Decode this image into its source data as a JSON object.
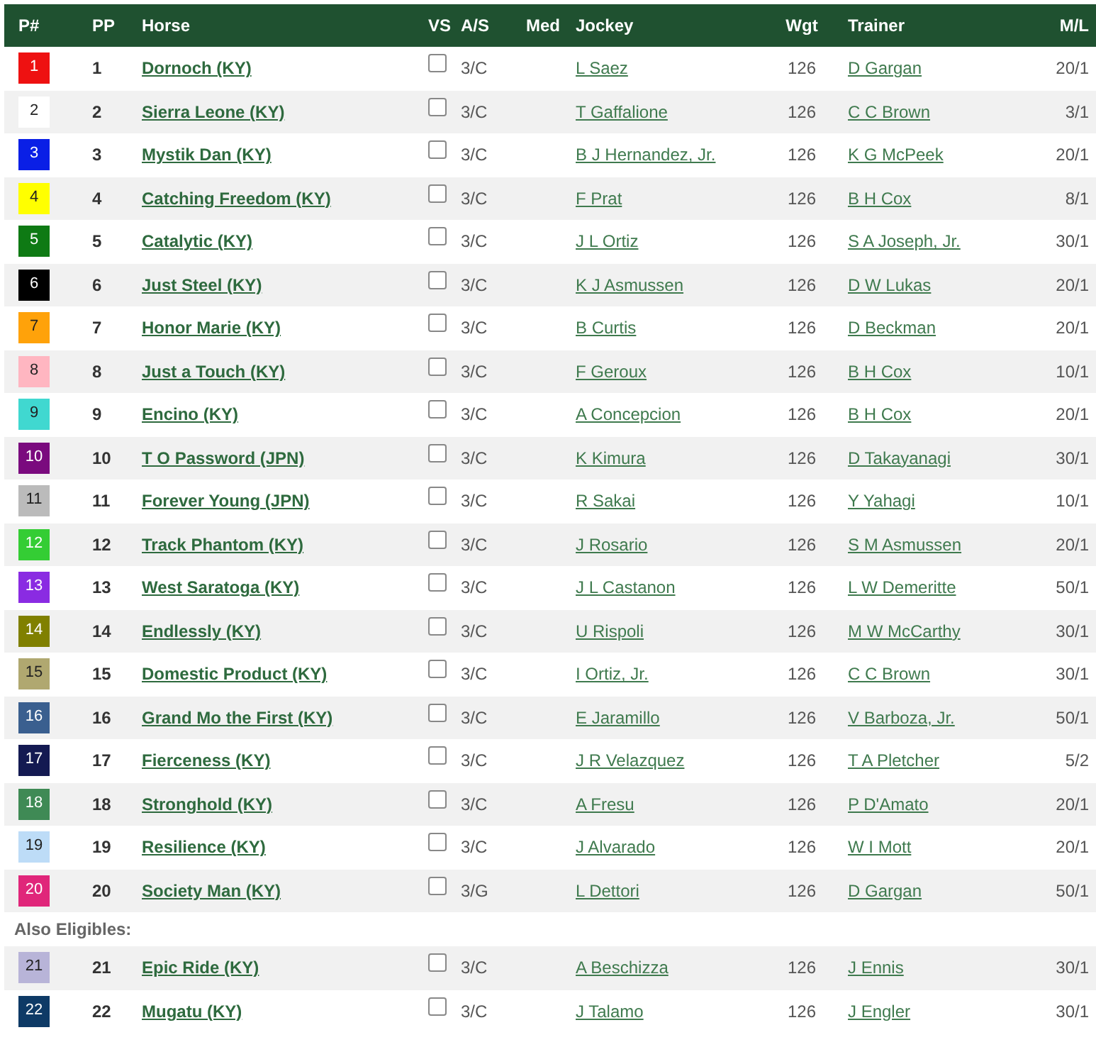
{
  "table": {
    "columns": [
      "P#",
      "PP",
      "Horse",
      "VS",
      "A/S",
      "Med",
      "Jockey",
      "Wgt",
      "Trainer",
      "M/L"
    ],
    "rows": [
      {
        "kind": "entry",
        "program": "1",
        "color": "#ee1111",
        "post": "1",
        "horse": "Dornoch (KY)",
        "vs_checked": false,
        "age_sex": "3/C",
        "jockey": "L Saez",
        "weight": "126",
        "trainer": "D Gargan",
        "odds": "20/1"
      },
      {
        "kind": "entry",
        "program": "2",
        "color": "#ffffff",
        "post": "2",
        "horse": "Sierra Leone (KY)",
        "vs_checked": false,
        "age_sex": "3/C",
        "jockey": "T Gaffalione",
        "weight": "126",
        "trainer": "C C Brown",
        "odds": "3/1"
      },
      {
        "kind": "entry",
        "program": "3",
        "color": "#0a1fe6",
        "post": "3",
        "horse": "Mystik Dan (KY)",
        "vs_checked": false,
        "age_sex": "3/C",
        "jockey": "B J Hernandez, Jr.",
        "weight": "126",
        "trainer": "K G McPeek",
        "odds": "20/1"
      },
      {
        "kind": "entry",
        "program": "4",
        "color": "#ffff00",
        "post": "4",
        "horse": "Catching Freedom (KY)",
        "vs_checked": false,
        "age_sex": "3/C",
        "jockey": "F Prat",
        "weight": "126",
        "trainer": "B H Cox",
        "odds": "8/1"
      },
      {
        "kind": "entry",
        "program": "5",
        "color": "#0e7a14",
        "post": "5",
        "horse": "Catalytic (KY)",
        "vs_checked": false,
        "age_sex": "3/C",
        "jockey": "J L Ortiz",
        "weight": "126",
        "trainer": "S A Joseph, Jr.",
        "odds": "30/1"
      },
      {
        "kind": "entry",
        "program": "6",
        "color": "#000000",
        "post": "6",
        "horse": "Just Steel (KY)",
        "vs_checked": false,
        "age_sex": "3/C",
        "jockey": "K J Asmussen",
        "weight": "126",
        "trainer": "D W Lukas",
        "odds": "20/1"
      },
      {
        "kind": "entry",
        "program": "7",
        "color": "#ffa20a",
        "post": "7",
        "horse": "Honor Marie (KY)",
        "vs_checked": false,
        "age_sex": "3/C",
        "jockey": "B Curtis",
        "weight": "126",
        "trainer": "D Beckman",
        "odds": "20/1"
      },
      {
        "kind": "entry",
        "program": "8",
        "color": "#ffb6c1",
        "post": "8",
        "horse": "Just a Touch (KY)",
        "vs_checked": false,
        "age_sex": "3/C",
        "jockey": "F Geroux",
        "weight": "126",
        "trainer": "B H Cox",
        "odds": "10/1"
      },
      {
        "kind": "entry",
        "program": "9",
        "color": "#40d8d0",
        "post": "9",
        "horse": "Encino (KY)",
        "vs_checked": false,
        "age_sex": "3/C",
        "jockey": "A Concepcion",
        "weight": "126",
        "trainer": "B H Cox",
        "odds": "20/1"
      },
      {
        "kind": "entry",
        "program": "10",
        "color": "#7a0a7e",
        "post": "10",
        "horse": "T O Password (JPN)",
        "vs_checked": false,
        "age_sex": "3/C",
        "jockey": "K Kimura",
        "weight": "126",
        "trainer": "D Takayanagi",
        "odds": "30/1"
      },
      {
        "kind": "entry",
        "program": "11",
        "color": "#bbbbbb",
        "post": "11",
        "horse": "Forever Young (JPN)",
        "vs_checked": false,
        "age_sex": "3/C",
        "jockey": "R Sakai",
        "weight": "126",
        "trainer": "Y Yahagi",
        "odds": "10/1"
      },
      {
        "kind": "entry",
        "program": "12",
        "color": "#34cd34",
        "post": "12",
        "horse": "Track Phantom (KY)",
        "vs_checked": false,
        "age_sex": "3/C",
        "jockey": "J Rosario",
        "weight": "126",
        "trainer": "S M Asmussen",
        "odds": "20/1"
      },
      {
        "kind": "entry",
        "program": "13",
        "color": "#8a2be2",
        "post": "13",
        "horse": "West Saratoga (KY)",
        "vs_checked": false,
        "age_sex": "3/C",
        "jockey": "J L Castanon",
        "weight": "126",
        "trainer": "L W Demeritte",
        "odds": "50/1"
      },
      {
        "kind": "entry",
        "program": "14",
        "color": "#808000",
        "post": "14",
        "horse": "Endlessly (KY)",
        "vs_checked": false,
        "age_sex": "3/C",
        "jockey": "U Rispoli",
        "weight": "126",
        "trainer": "M W McCarthy",
        "odds": "30/1"
      },
      {
        "kind": "entry",
        "program": "15",
        "color": "#b0a870",
        "post": "15",
        "horse": "Domestic Product (KY)",
        "vs_checked": false,
        "age_sex": "3/C",
        "jockey": "I Ortiz, Jr.",
        "weight": "126",
        "trainer": "C C Brown",
        "odds": "30/1"
      },
      {
        "kind": "entry",
        "program": "16",
        "color": "#3a5f8f",
        "post": "16",
        "horse": "Grand Mo the First (KY)",
        "vs_checked": false,
        "age_sex": "3/C",
        "jockey": "E Jaramillo",
        "weight": "126",
        "trainer": "V Barboza, Jr.",
        "odds": "50/1"
      },
      {
        "kind": "entry",
        "program": "17",
        "color": "#141a52",
        "post": "17",
        "horse": "Fierceness (KY)",
        "vs_checked": false,
        "age_sex": "3/C",
        "jockey": "J R Velazquez",
        "weight": "126",
        "trainer": "T A Pletcher",
        "odds": "5/2"
      },
      {
        "kind": "entry",
        "program": "18",
        "color": "#3f8a55",
        "post": "18",
        "horse": "Stronghold (KY)",
        "vs_checked": false,
        "age_sex": "3/C",
        "jockey": "A Fresu",
        "weight": "126",
        "trainer": "P D'Amato",
        "odds": "20/1"
      },
      {
        "kind": "entry",
        "program": "19",
        "color": "#bddcf7",
        "post": "19",
        "horse": "Resilience (KY)",
        "vs_checked": false,
        "age_sex": "3/C",
        "jockey": "J Alvarado",
        "weight": "126",
        "trainer": "W I Mott",
        "odds": "20/1"
      },
      {
        "kind": "entry",
        "program": "20",
        "color": "#e0267a",
        "post": "20",
        "horse": "Society Man (KY)",
        "vs_checked": false,
        "age_sex": "3/G",
        "jockey": "L Dettori",
        "weight": "126",
        "trainer": "D Gargan",
        "odds": "50/1"
      },
      {
        "kind": "section",
        "label": "Also Eligibles:"
      },
      {
        "kind": "entry",
        "program": "21",
        "color": "#b8b4d8",
        "post": "21",
        "horse": "Epic Ride (KY)",
        "vs_checked": false,
        "age_sex": "3/C",
        "jockey": "A Beschizza",
        "weight": "126",
        "trainer": "J Ennis",
        "odds": "30/1"
      },
      {
        "kind": "entry",
        "program": "22",
        "color": "#0e3a66",
        "post": "22",
        "horse": "Mugatu (KY)",
        "vs_checked": false,
        "age_sex": "3/C",
        "jockey": "J Talamo",
        "weight": "126",
        "trainer": "J Engler",
        "odds": "30/1"
      }
    ]
  }
}
